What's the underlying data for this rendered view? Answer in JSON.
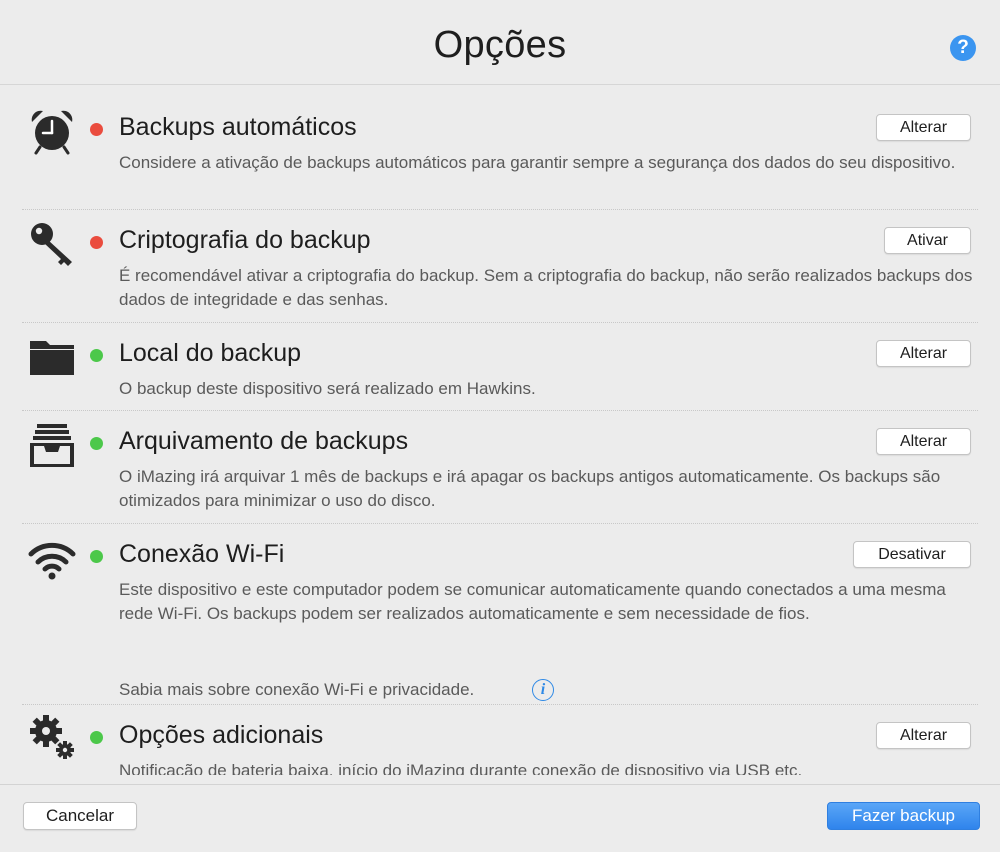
{
  "header": {
    "title": "Opções",
    "help_label": "?"
  },
  "sections": [
    {
      "title": "Backups automáticos",
      "status": "red",
      "icon": "alarm-clock-icon",
      "description": "Considere a ativação de backups automáticos para garantir sempre a segurança dos dados do seu dispositivo.",
      "button": "Alterar"
    },
    {
      "title": "Criptografia do backup",
      "status": "red",
      "icon": "key-icon",
      "description": "É recomendável ativar a criptografia do backup. Sem a criptografia do backup, não serão realizados backups dos dados de integridade e das senhas.",
      "button": "Ativar"
    },
    {
      "title": "Local do backup",
      "status": "green",
      "icon": "folder-icon",
      "description": "O backup deste dispositivo será realizado em Hawkins.",
      "button": "Alterar"
    },
    {
      "title": "Arquivamento de backups",
      "status": "green",
      "icon": "archive-tray-icon",
      "description": "O iMazing irá arquivar 1 mês de backups e irá apagar os backups antigos automaticamente. Os backups são otimizados para minimizar o uso do disco.",
      "button": "Alterar"
    },
    {
      "title": "Conexão Wi-Fi",
      "status": "green",
      "icon": "wifi-icon",
      "description": "Este dispositivo e este computador podem se comunicar automaticamente quando conectados a uma mesma rede Wi-Fi. Os backups podem ser realizados automaticamente e sem necessidade de fios.",
      "note": "Sabia mais sobre conexão Wi-Fi e privacidade.",
      "button": "Desativar"
    },
    {
      "title": "Opções adicionais",
      "status": "green",
      "icon": "gears-icon",
      "description": "Notificação de bateria baixa, início do iMazing durante conexão de dispositivo via USB etc.",
      "button": "Alterar"
    }
  ],
  "colors": {
    "status_red": "#ea4c3e",
    "status_green": "#4cc84a",
    "primary": "#3a8ff0"
  },
  "footer": {
    "cancel": "Cancelar",
    "primary": "Fazer backup"
  }
}
